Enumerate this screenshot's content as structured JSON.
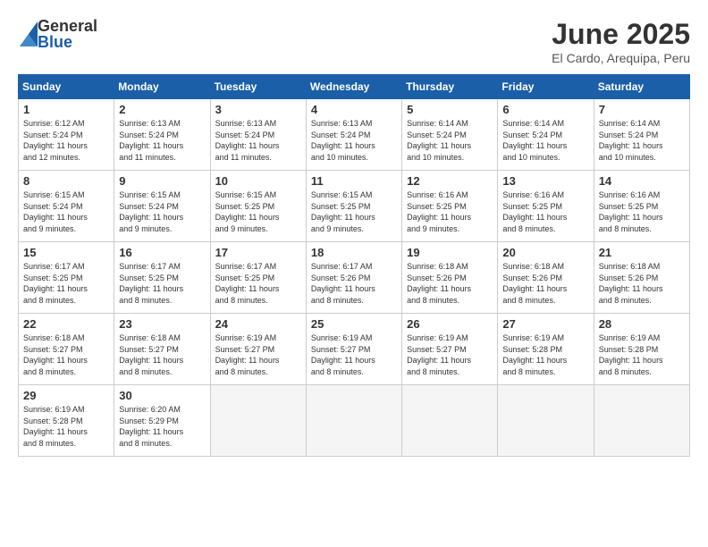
{
  "logo": {
    "general": "General",
    "blue": "Blue"
  },
  "title": "June 2025",
  "location": "El Cardo, Arequipa, Peru",
  "days_of_week": [
    "Sunday",
    "Monday",
    "Tuesday",
    "Wednesday",
    "Thursday",
    "Friday",
    "Saturday"
  ],
  "weeks": [
    [
      {
        "day": "1",
        "info": "Sunrise: 6:12 AM\nSunset: 5:24 PM\nDaylight: 11 hours\nand 12 minutes."
      },
      {
        "day": "2",
        "info": "Sunrise: 6:13 AM\nSunset: 5:24 PM\nDaylight: 11 hours\nand 11 minutes."
      },
      {
        "day": "3",
        "info": "Sunrise: 6:13 AM\nSunset: 5:24 PM\nDaylight: 11 hours\nand 11 minutes."
      },
      {
        "day": "4",
        "info": "Sunrise: 6:13 AM\nSunset: 5:24 PM\nDaylight: 11 hours\nand 10 minutes."
      },
      {
        "day": "5",
        "info": "Sunrise: 6:14 AM\nSunset: 5:24 PM\nDaylight: 11 hours\nand 10 minutes."
      },
      {
        "day": "6",
        "info": "Sunrise: 6:14 AM\nSunset: 5:24 PM\nDaylight: 11 hours\nand 10 minutes."
      },
      {
        "day": "7",
        "info": "Sunrise: 6:14 AM\nSunset: 5:24 PM\nDaylight: 11 hours\nand 10 minutes."
      }
    ],
    [
      {
        "day": "8",
        "info": "Sunrise: 6:15 AM\nSunset: 5:24 PM\nDaylight: 11 hours\nand 9 minutes."
      },
      {
        "day": "9",
        "info": "Sunrise: 6:15 AM\nSunset: 5:24 PM\nDaylight: 11 hours\nand 9 minutes."
      },
      {
        "day": "10",
        "info": "Sunrise: 6:15 AM\nSunset: 5:25 PM\nDaylight: 11 hours\nand 9 minutes."
      },
      {
        "day": "11",
        "info": "Sunrise: 6:15 AM\nSunset: 5:25 PM\nDaylight: 11 hours\nand 9 minutes."
      },
      {
        "day": "12",
        "info": "Sunrise: 6:16 AM\nSunset: 5:25 PM\nDaylight: 11 hours\nand 9 minutes."
      },
      {
        "day": "13",
        "info": "Sunrise: 6:16 AM\nSunset: 5:25 PM\nDaylight: 11 hours\nand 8 minutes."
      },
      {
        "day": "14",
        "info": "Sunrise: 6:16 AM\nSunset: 5:25 PM\nDaylight: 11 hours\nand 8 minutes."
      }
    ],
    [
      {
        "day": "15",
        "info": "Sunrise: 6:17 AM\nSunset: 5:25 PM\nDaylight: 11 hours\nand 8 minutes."
      },
      {
        "day": "16",
        "info": "Sunrise: 6:17 AM\nSunset: 5:25 PM\nDaylight: 11 hours\nand 8 minutes."
      },
      {
        "day": "17",
        "info": "Sunrise: 6:17 AM\nSunset: 5:25 PM\nDaylight: 11 hours\nand 8 minutes."
      },
      {
        "day": "18",
        "info": "Sunrise: 6:17 AM\nSunset: 5:26 PM\nDaylight: 11 hours\nand 8 minutes."
      },
      {
        "day": "19",
        "info": "Sunrise: 6:18 AM\nSunset: 5:26 PM\nDaylight: 11 hours\nand 8 minutes."
      },
      {
        "day": "20",
        "info": "Sunrise: 6:18 AM\nSunset: 5:26 PM\nDaylight: 11 hours\nand 8 minutes."
      },
      {
        "day": "21",
        "info": "Sunrise: 6:18 AM\nSunset: 5:26 PM\nDaylight: 11 hours\nand 8 minutes."
      }
    ],
    [
      {
        "day": "22",
        "info": "Sunrise: 6:18 AM\nSunset: 5:27 PM\nDaylight: 11 hours\nand 8 minutes."
      },
      {
        "day": "23",
        "info": "Sunrise: 6:18 AM\nSunset: 5:27 PM\nDaylight: 11 hours\nand 8 minutes."
      },
      {
        "day": "24",
        "info": "Sunrise: 6:19 AM\nSunset: 5:27 PM\nDaylight: 11 hours\nand 8 minutes."
      },
      {
        "day": "25",
        "info": "Sunrise: 6:19 AM\nSunset: 5:27 PM\nDaylight: 11 hours\nand 8 minutes."
      },
      {
        "day": "26",
        "info": "Sunrise: 6:19 AM\nSunset: 5:27 PM\nDaylight: 11 hours\nand 8 minutes."
      },
      {
        "day": "27",
        "info": "Sunrise: 6:19 AM\nSunset: 5:28 PM\nDaylight: 11 hours\nand 8 minutes."
      },
      {
        "day": "28",
        "info": "Sunrise: 6:19 AM\nSunset: 5:28 PM\nDaylight: 11 hours\nand 8 minutes."
      }
    ],
    [
      {
        "day": "29",
        "info": "Sunrise: 6:19 AM\nSunset: 5:28 PM\nDaylight: 11 hours\nand 8 minutes."
      },
      {
        "day": "30",
        "info": "Sunrise: 6:20 AM\nSunset: 5:29 PM\nDaylight: 11 hours\nand 8 minutes."
      },
      {
        "day": "",
        "info": ""
      },
      {
        "day": "",
        "info": ""
      },
      {
        "day": "",
        "info": ""
      },
      {
        "day": "",
        "info": ""
      },
      {
        "day": "",
        "info": ""
      }
    ]
  ]
}
